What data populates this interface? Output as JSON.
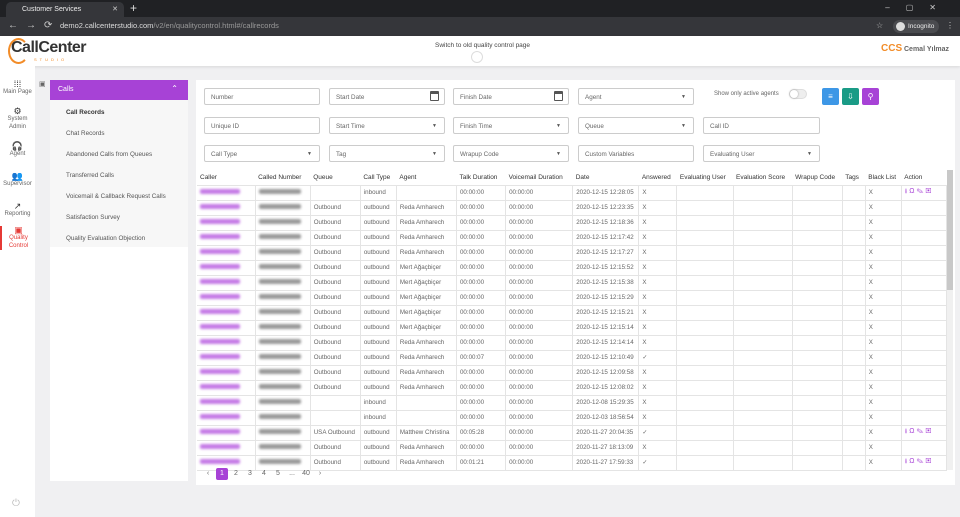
{
  "browser": {
    "tab_title": "Customer Services",
    "url_host": "demo2.callcenterstudio.com",
    "url_path": "/v2/en/qualitycontrol.html#/callrecords",
    "profile": "Incognito"
  },
  "header": {
    "logo": "CallCenter",
    "logo_sub": "STUDIO",
    "switch_label": "Switch to old quality control page",
    "brand": "CCS",
    "user": "Cemal Yılmaz"
  },
  "rail": [
    {
      "label": "Main Page",
      "icon": "⁞⁞⁞"
    },
    {
      "label": "System Admin",
      "icon": "⚙"
    },
    {
      "label": "Agent",
      "icon": "🎧"
    },
    {
      "label": "Supervisor",
      "icon": "👥"
    },
    {
      "label": "Reporting",
      "icon": "↗"
    },
    {
      "label": "Quality Control",
      "icon": "▣"
    }
  ],
  "submenu": {
    "title": "Calls",
    "items": [
      "Call Records",
      "Chat Records",
      "Abandoned Calls from Queues",
      "Transferred Calls",
      "Voicemail & Callback Request Calls",
      "Satisfaction Survey",
      "Quality Evaluation Objection"
    ]
  },
  "filters": {
    "number": "Number",
    "start_date": "Start Date",
    "finish_date": "Finish Date",
    "agent": "Agent",
    "active_label": "Show only active agents",
    "unique_id": "Unique ID",
    "start_time": "Start Time",
    "finish_time": "Finish Time",
    "queue": "Queue",
    "call_id": "Call ID",
    "call_type": "Call Type",
    "tag": "Tag",
    "wrapup": "Wrapup Code",
    "custom": "Custom Variables",
    "eval_user": "Evaluating User"
  },
  "buttons": {
    "colors": {
      "filter": "#3d97e6",
      "download": "#1a9b86",
      "search": "#a742d6"
    }
  },
  "table": {
    "columns": [
      "Caller",
      "Called Number",
      "Queue",
      "Call Type",
      "Agent",
      "Talk Duration",
      "Voicemail Duration",
      "Date",
      "Answered",
      "Evaluating User",
      "Evaluation Score",
      "Wrapup Code",
      "Tags",
      "Black List",
      "Action"
    ],
    "rows": [
      [
        "",
        "inbound",
        "",
        "00:00:00",
        "00:00:00",
        "2020-12-15 12:28:05",
        "X",
        "X",
        true
      ],
      [
        "Outbound",
        "outbound",
        "Reda Amharech",
        "00:00:00",
        "00:00:00",
        "2020-12-15 12:23:35",
        "X",
        "X",
        false
      ],
      [
        "Outbound",
        "outbound",
        "Reda Amharech",
        "00:00:00",
        "00:00:00",
        "2020-12-15 12:18:36",
        "X",
        "X",
        false
      ],
      [
        "Outbound",
        "outbound",
        "Reda Amharech",
        "00:00:00",
        "00:00:00",
        "2020-12-15 12:17:42",
        "X",
        "X",
        false
      ],
      [
        "Outbound",
        "outbound",
        "Reda Amharech",
        "00:00:00",
        "00:00:00",
        "2020-12-15 12:17:27",
        "X",
        "X",
        false
      ],
      [
        "Outbound",
        "outbound",
        "Mert Ağaçbiçer",
        "00:00:00",
        "00:00:00",
        "2020-12-15 12:15:52",
        "X",
        "X",
        false
      ],
      [
        "Outbound",
        "outbound",
        "Mert Ağaçbiçer",
        "00:00:00",
        "00:00:00",
        "2020-12-15 12:15:38",
        "X",
        "X",
        false
      ],
      [
        "Outbound",
        "outbound",
        "Mert Ağaçbiçer",
        "00:00:00",
        "00:00:00",
        "2020-12-15 12:15:29",
        "X",
        "X",
        false
      ],
      [
        "Outbound",
        "outbound",
        "Mert Ağaçbiçer",
        "00:00:00",
        "00:00:00",
        "2020-12-15 12:15:21",
        "X",
        "X",
        false
      ],
      [
        "Outbound",
        "outbound",
        "Mert Ağaçbiçer",
        "00:00:00",
        "00:00:00",
        "2020-12-15 12:15:14",
        "X",
        "X",
        false
      ],
      [
        "Outbound",
        "outbound",
        "Reda Amharech",
        "00:00:00",
        "00:00:00",
        "2020-12-15 12:14:14",
        "X",
        "X",
        false
      ],
      [
        "Outbound",
        "outbound",
        "Reda Amharech",
        "00:00:07",
        "00:00:00",
        "2020-12-15 12:10:49",
        "✓",
        "X",
        false
      ],
      [
        "Outbound",
        "outbound",
        "Reda Amharech",
        "00:00:00",
        "00:00:00",
        "2020-12-15 12:09:58",
        "X",
        "X",
        false
      ],
      [
        "Outbound",
        "outbound",
        "Reda Amharech",
        "00:00:00",
        "00:00:00",
        "2020-12-15 12:08:02",
        "X",
        "X",
        false
      ],
      [
        "",
        "inbound",
        "",
        "00:00:00",
        "00:00:00",
        "2020-12-08 15:29:35",
        "X",
        "X",
        false
      ],
      [
        "",
        "inbound",
        "",
        "00:00:00",
        "00:00:00",
        "2020-12-03 18:56:54",
        "X",
        "X",
        false
      ],
      [
        "USA Outbound",
        "outbound",
        "Matthew Christina",
        "00:05:28",
        "00:00:00",
        "2020-11-27 20:04:35",
        "✓",
        "X",
        true
      ],
      [
        "Outbound",
        "outbound",
        "Reda Amharech",
        "00:00:00",
        "00:00:00",
        "2020-11-27 18:13:09",
        "X",
        "X",
        false
      ],
      [
        "Outbound",
        "outbound",
        "Reda Amharech",
        "00:01:21",
        "00:00:00",
        "2020-11-27 17:59:33",
        "✓",
        "X",
        true
      ]
    ]
  },
  "pagination": {
    "prev": "‹",
    "pages": [
      "1",
      "2",
      "3",
      "4",
      "5",
      "...",
      "40"
    ],
    "next": "›",
    "current": "1"
  }
}
